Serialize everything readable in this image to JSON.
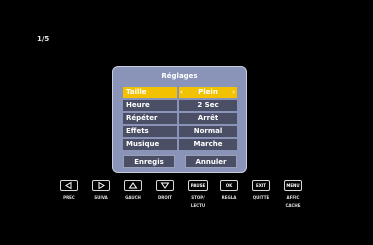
{
  "counter": "1/5",
  "dialog": {
    "title": "Réglages",
    "rows": [
      {
        "label": "Taille",
        "value": "Plein",
        "selected": true
      },
      {
        "label": "Heure",
        "value": "2 Sec"
      },
      {
        "label": "Répéter",
        "value": "Arrêt"
      },
      {
        "label": "Effets",
        "value": "Normal"
      },
      {
        "label": "Musique",
        "value": "Marche"
      }
    ],
    "save_label": "Enregis",
    "cancel_label": "Annuler"
  },
  "keys": [
    {
      "icon": "left-arrow-icon",
      "label": "PREC"
    },
    {
      "icon": "right-arrow-icon",
      "label": "SUIVA"
    },
    {
      "icon": "up-arrow-icon",
      "label": "GAUCH"
    },
    {
      "icon": "down-arrow-icon",
      "label": "DROIT"
    },
    {
      "text": "PAUSE",
      "label1": "STOP/",
      "label2": "LECTU"
    },
    {
      "text": "OK",
      "label": "REGLA"
    },
    {
      "text": "EXIT",
      "label": "QUITTE"
    },
    {
      "text": "MENU",
      "label1": "AFFIC",
      "label2": "CACHE"
    }
  ],
  "colors": {
    "selected": "#f2c200",
    "row": "#4a4f66",
    "dialog": "#8a94b8"
  }
}
